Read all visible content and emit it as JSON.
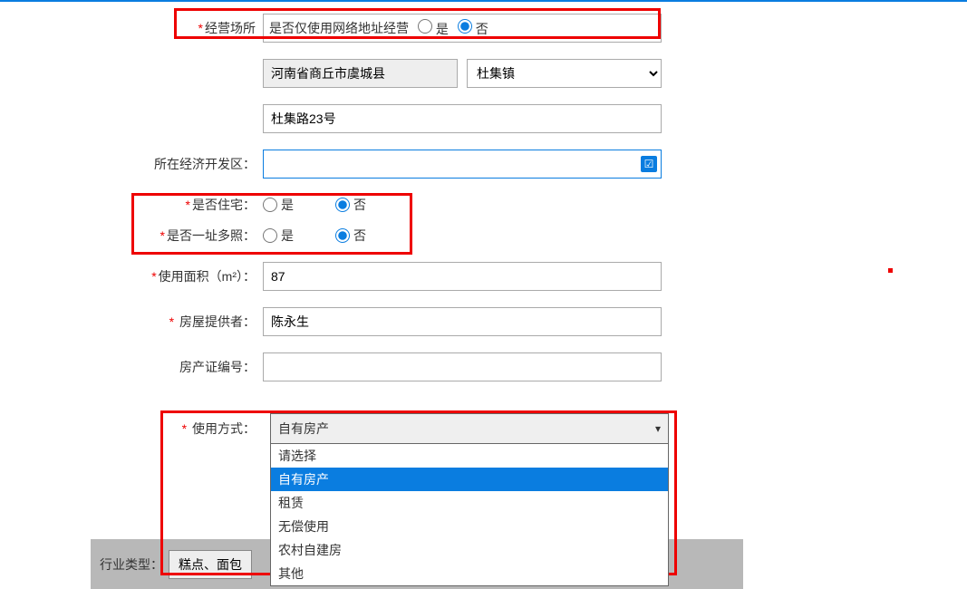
{
  "labels": {
    "business_place": "经营场所",
    "network_only_q": "是否仅使用网络地址经营",
    "yes": "是",
    "no": "否",
    "dev_zone": "所在经济开发区：",
    "is_residence": "是否住宅：",
    "multi_license": "是否一址多照：",
    "area": "使用面积（m²）：",
    "house_provider": "房屋提供者：",
    "cert_no": "房产证编号：",
    "use_method": "使用方式：",
    "industry_type": "行业类型：",
    "pastry_btn": "糕点、面包"
  },
  "values": {
    "region_readonly": "河南省商丘市虞城县",
    "town": "杜集镇",
    "address": "杜集路23号",
    "area": "87",
    "provider": "陈永生",
    "cert_no": "",
    "use_method_selected": "自有房产"
  },
  "options": {
    "use_method": [
      "请选择",
      "自有房产",
      "租赁",
      "无偿使用",
      "农村自建房",
      "其他"
    ]
  }
}
